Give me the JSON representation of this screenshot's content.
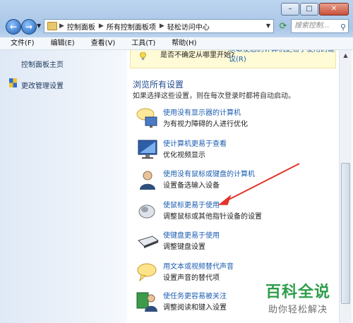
{
  "window": {
    "min_glyph": "–",
    "max_glyph": "□",
    "close_glyph": "✕"
  },
  "address": {
    "crumbs": [
      "控制面板",
      "所有控制面板项",
      "轻松访问中心"
    ],
    "search_placeholder": "搜索控制..."
  },
  "menu": [
    "文件(F)",
    "编辑(E)",
    "查看(V)",
    "工具(T)",
    "帮助(H)"
  ],
  "sidebar": {
    "items": [
      "控制面板主页",
      "更改管理设置"
    ]
  },
  "tip": {
    "question": "是否不确定从哪里开始?",
    "answer": "获取使您的计算机更易于使用的建议(R)"
  },
  "main": {
    "heading": "浏览所有设置",
    "description": "如果选择这些设置，则在每次登录时都将自动启动。",
    "items": [
      {
        "title": "使用没有显示器的计算机",
        "sub": "为有视力障碍的人进行优化",
        "icon": "speech-monitor-icon"
      },
      {
        "title": "使计算机更易于查看",
        "sub": "优化视频显示",
        "icon": "monitor-icon"
      },
      {
        "title": "使用没有鼠标或键盘的计算机",
        "sub": "设置备选输入设备",
        "icon": "user-icon"
      },
      {
        "title": "使鼠标更易于使用",
        "sub": "调整鼠标或其他指针设备的设置",
        "icon": "mouse-icon"
      },
      {
        "title": "使键盘更易于使用",
        "sub": "调整键盘设置",
        "icon": "keyboard-icon"
      },
      {
        "title": "用文本或视频替代声音",
        "sub": "设置声音的替代项",
        "icon": "speech-bubble-icon"
      },
      {
        "title": "使任务更容易被关注",
        "sub": "调整阅读和键入设置",
        "icon": "user-screen-icon"
      }
    ]
  },
  "watermark": {
    "title": "百科全说",
    "subtitle": "助你轻松解决"
  },
  "colors": {
    "link": "#1a5cb0",
    "heading": "#1f4a8e",
    "annotation_arrow": "#e0342b",
    "watermark_green": "#2f9d4c"
  }
}
